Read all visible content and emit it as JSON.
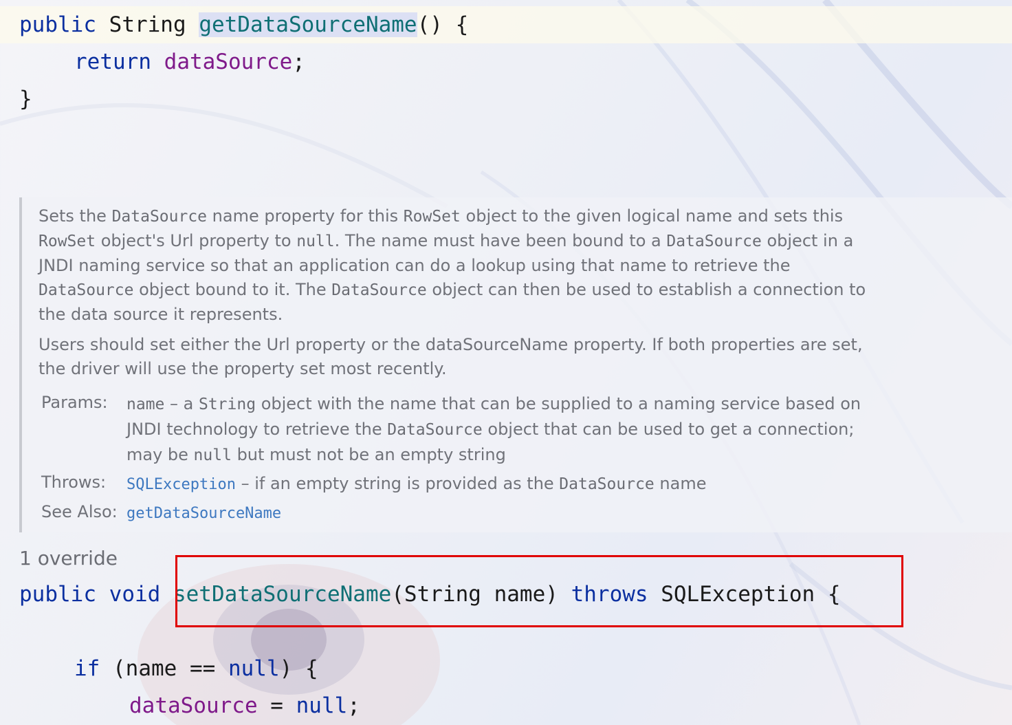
{
  "editor": {
    "line1": {
      "kw1": "public",
      "type": "String",
      "method": "getDataSourceName",
      "tail": "() {"
    },
    "line2": {
      "kw": "return",
      "field": "dataSource",
      "tail": ";"
    },
    "line3": {
      "text": "}"
    },
    "doc": {
      "para1": {
        "t1": "Sets the ",
        "c1": "DataSource",
        "t2": " name property for this ",
        "c2": "RowSet",
        "t3": " object to the given logical name and sets this ",
        "c3": "RowSet",
        "t4": " object's Url property to ",
        "c4": "null",
        "t5": ". The name must have been bound to a ",
        "c5": "DataSource",
        "t6": " object in a JNDI naming service so that an application can do a lookup using that name to retrieve the ",
        "c6": "DataSource",
        "t7": " object bound to it. The ",
        "c7": "DataSource",
        "t8": " object can then be used to establish a connection to the data source it represents."
      },
      "para2": "Users should set either the Url property or the dataSourceName property. If both properties are set, the driver will use the property set most recently.",
      "params": {
        "label": "Params:",
        "c1": "name",
        "t1": " – a ",
        "c2": "String",
        "t2": " object with the name that can be supplied to a naming service based on JNDI technology to retrieve the ",
        "c3": "DataSource",
        "t3": " object that can be used to get a connection; may be ",
        "c4": "null",
        "t4": " but must not be an empty string"
      },
      "throws": {
        "label": "Throws:",
        "link": "SQLException",
        "t1": " – if an empty string is provided as the ",
        "c1": "DataSource",
        "t2": " name"
      },
      "see_also": {
        "label": "See Also:",
        "link": "getDataSourceName"
      }
    },
    "override_label": "1 override",
    "line4": {
      "kw1": "public",
      "kw2": "void",
      "method": "setDataSourceName",
      "params": "(String name)",
      "kw3": "throws",
      "exc": "SQLException",
      "tail": "{"
    },
    "line5": {
      "kw": "if",
      "cond1": "(name == ",
      "null_kw": "null",
      "cond2": ") {"
    },
    "line6": {
      "field": "dataSource",
      "eq": " = ",
      "null_kw": "null",
      "tail": ";"
    }
  },
  "colors": {
    "keyword": "#0b2fa0",
    "method": "#0f6f74",
    "field": "#7f1a8a",
    "link": "#3d78c0",
    "annotation_box": "#e00000"
  }
}
